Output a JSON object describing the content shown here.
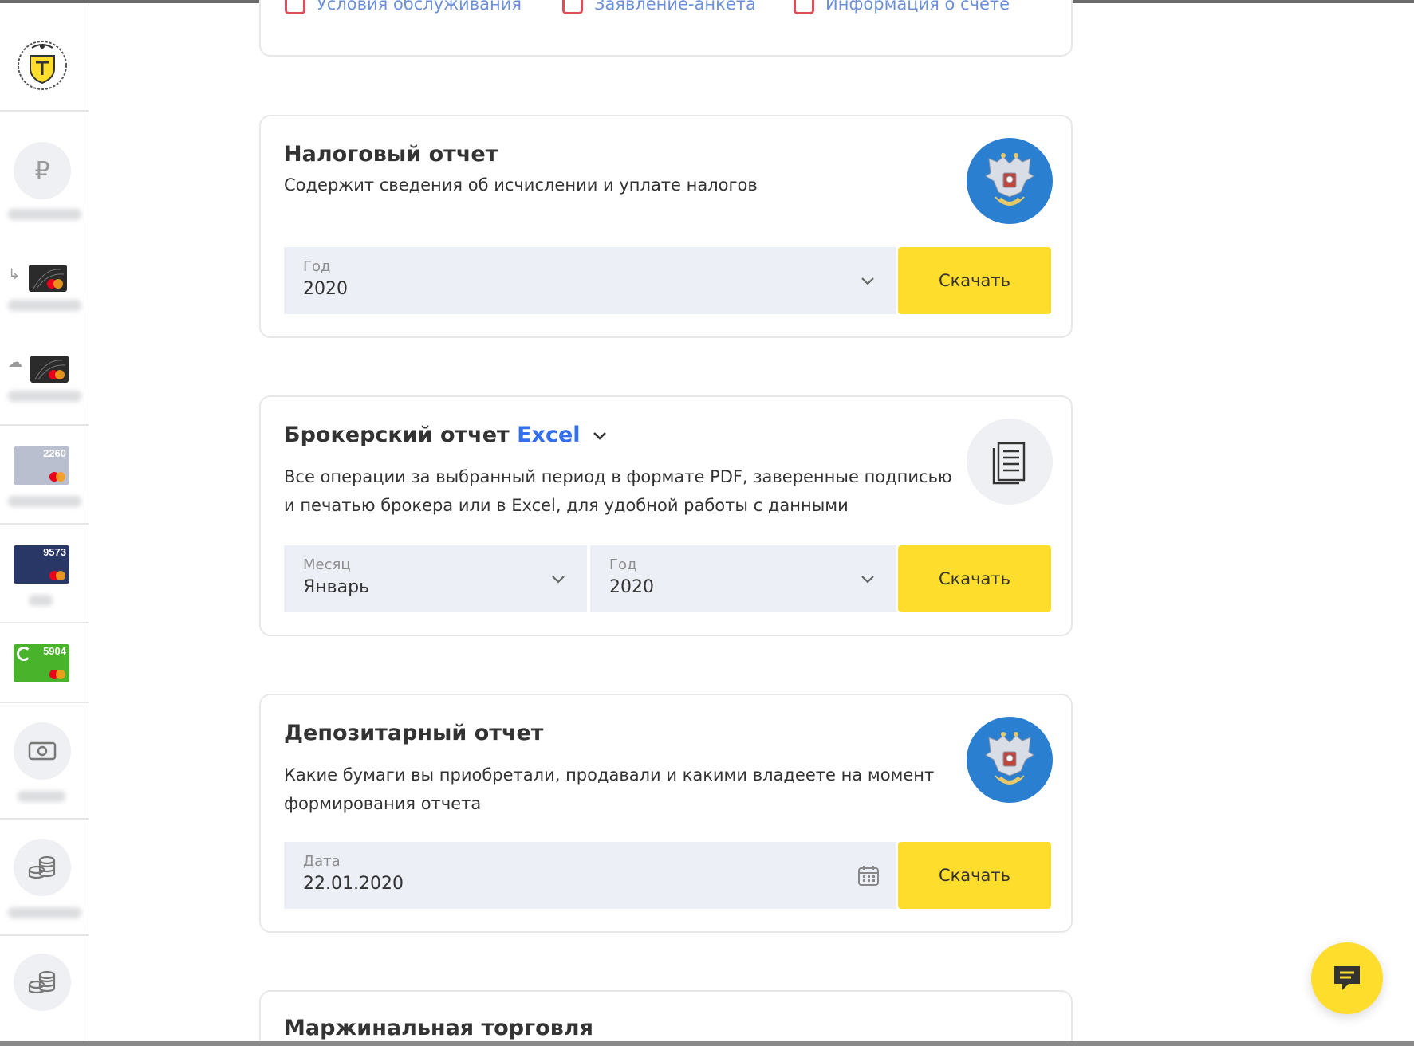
{
  "top_card": {
    "links": [
      {
        "label": "Условия обслуживания"
      },
      {
        "label": "Заявление-анкета"
      },
      {
        "label": "Информация о счете"
      }
    ]
  },
  "sidebar": {
    "cards": [
      {
        "number": "2260"
      },
      {
        "number": "9573"
      },
      {
        "number": "5904"
      }
    ]
  },
  "tax_report": {
    "title": "Налоговый отчет",
    "description": "Содержит сведения об исчислении и уплате налогов",
    "year_label": "Год",
    "year_value": "2020",
    "download_label": "Скачать"
  },
  "broker_report": {
    "title": "Брокерский отчет",
    "format": "Excel",
    "description_line1": "Все операции за выбранный период в формате PDF, заверенные подписью",
    "description_line2": "и печатью брокера или в Excel, для удобной работы с данными",
    "month_label": "Месяц",
    "month_value": "Январь",
    "year_label": "Год",
    "year_value": "2020",
    "download_label": "Скачать"
  },
  "depository_report": {
    "title": "Депозитарный отчет",
    "description_line1": "Какие бумаги вы приобретали, продавали и какими владеете на момент",
    "description_line2": "формирования отчета",
    "date_label": "Дата",
    "date_value": "22.01.2020",
    "download_label": "Скачать"
  },
  "margin_trading": {
    "title": "Маржинальная торговля"
  },
  "colors": {
    "accent_yellow": "#ffdd2d",
    "link_blue": "#336fee",
    "field_bg": "#eceff6",
    "emblem_blue": "#2b7fd0"
  },
  "icons": {
    "sidebar_logo": "tinkoff-emblem-icon",
    "ruble": "ruble-icon",
    "wallet": "wallet-icon",
    "coins": "coins-icon",
    "document": "document-icon",
    "calendar": "calendar-icon",
    "chat": "chat-icon",
    "emblem": "russia-emblem-icon"
  }
}
